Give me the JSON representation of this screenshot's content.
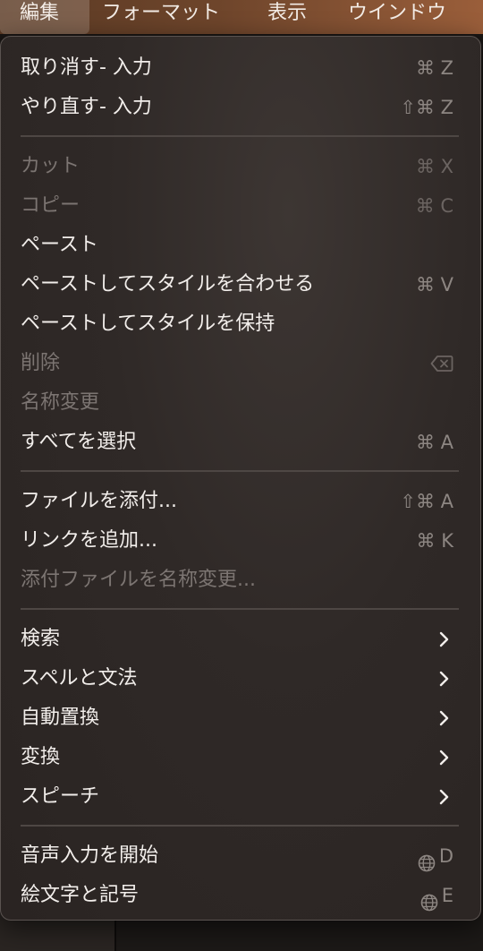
{
  "menubar": {
    "items": [
      {
        "label": "編集"
      },
      {
        "label": "フォーマット"
      },
      {
        "label": "表示"
      },
      {
        "label": "ウインドウ"
      }
    ]
  },
  "menu": {
    "undo": {
      "label": "取り消す- 入力",
      "shortcut": "⌘ Z"
    },
    "redo": {
      "label": "やり直す- 入力",
      "shortcut": "⇧⌘ Z"
    },
    "cut": {
      "label": "カット",
      "shortcut": "⌘ X"
    },
    "copy": {
      "label": "コピー",
      "shortcut": "⌘ C"
    },
    "paste": {
      "label": "ペースト"
    },
    "paste_match": {
      "label": "ペーストしてスタイルを合わせる",
      "shortcut": "⌘ V"
    },
    "paste_keep": {
      "label": "ペーストしてスタイルを保持"
    },
    "delete": {
      "label": "削除"
    },
    "rename": {
      "label": "名称変更"
    },
    "select_all": {
      "label": "すべてを選択",
      "shortcut": "⌘ A"
    },
    "attach_file": {
      "label": "ファイルを添付...",
      "shortcut": "⇧⌘ A"
    },
    "add_link": {
      "label": "リンクを追加...",
      "shortcut": "⌘ K"
    },
    "rename_attachment": {
      "label": "添付ファイルを名称変更..."
    },
    "find": {
      "label": "検索"
    },
    "spelling": {
      "label": "スペルと文法"
    },
    "substitutions": {
      "label": "自動置換"
    },
    "transformations": {
      "label": "変換"
    },
    "speech": {
      "label": "スピーチ"
    },
    "dictation": {
      "label": "音声入力を開始",
      "shortcut": "D"
    },
    "emoji": {
      "label": "絵文字と記号",
      "shortcut": "E"
    }
  },
  "colors": {
    "menubar_accent": "#8a5535",
    "menu_background": "#2f2927",
    "enabled_text": "#f2eeeb",
    "disabled_text": "#7c7572"
  }
}
